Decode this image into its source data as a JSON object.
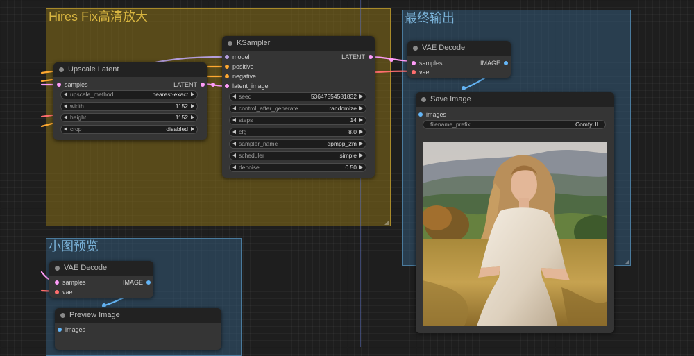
{
  "colors": {
    "latent": "#ff9cf9",
    "vae": "#ff6e6e",
    "image": "#64b5f6",
    "model": "#b39ddb",
    "conditioning": "#ffa931"
  },
  "groups": {
    "hires_title": "Hires Fix高清放大",
    "final_title": "最终输出",
    "preview_title": "小图预览"
  },
  "upscale_latent": {
    "title": "Upscale Latent",
    "input_samples": "samples",
    "output_latent": "LATENT",
    "widgets": [
      {
        "label": "upscale_method",
        "value": "nearest-exact"
      },
      {
        "label": "width",
        "value": "1152"
      },
      {
        "label": "height",
        "value": "1152"
      },
      {
        "label": "crop",
        "value": "disabled"
      }
    ]
  },
  "ksampler": {
    "title": "KSampler",
    "inputs": [
      "model",
      "positive",
      "negative",
      "latent_image"
    ],
    "output_latent": "LATENT",
    "widgets": [
      {
        "label": "seed",
        "value": "53647554581832"
      },
      {
        "label": "control_after_generate",
        "value": "randomize"
      },
      {
        "label": "steps",
        "value": "14"
      },
      {
        "label": "cfg",
        "value": "8.0"
      },
      {
        "label": "sampler_name",
        "value": "dpmpp_2m"
      },
      {
        "label": "scheduler",
        "value": "simple"
      },
      {
        "label": "denoise",
        "value": "0.50"
      }
    ]
  },
  "vae_decode_final": {
    "title": "VAE Decode",
    "input_samples": "samples",
    "input_vae": "vae",
    "output_image": "IMAGE"
  },
  "save_image": {
    "title": "Save Image",
    "input_images": "images",
    "filename_prefix_label": "filename_prefix",
    "filename_prefix_value": "ComfyUI"
  },
  "vae_decode_preview": {
    "title": "VAE Decode",
    "input_samples": "samples",
    "input_vae": "vae",
    "output_image": "IMAGE"
  },
  "preview_image": {
    "title": "Preview Image",
    "input_images": "images"
  }
}
